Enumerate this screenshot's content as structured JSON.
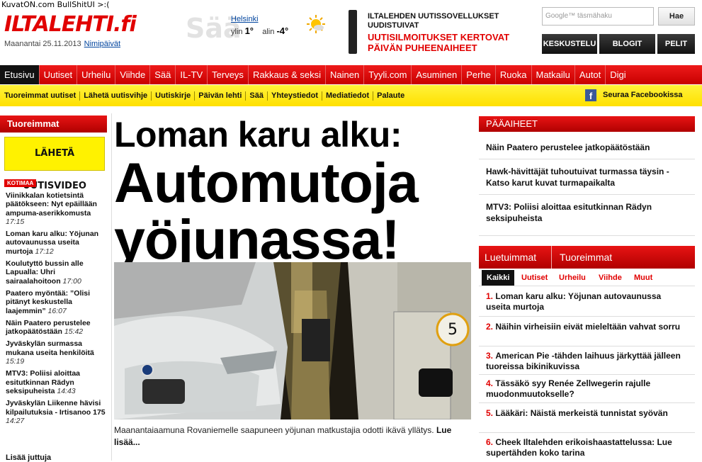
{
  "watermark": "KuvatON.com BullShitUI >:(",
  "brand": {
    "logo_main": "ILTALEHTI",
    "logo_suffix": ".fi",
    "date": "Maanantai 25.11.2013",
    "name_days": "Nimipäivät"
  },
  "weather": {
    "label": "Sää",
    "city": "Helsinki",
    "low_label": "ylin",
    "low": "1°",
    "high_label": "alin",
    "high": "-4°",
    "icon": "sun-cloud-icon"
  },
  "promo": {
    "line1": "ILTALEHDEN UUTISSOVELLUKSET UUDISTUIVAT",
    "line2": "UUTISILMOITUKSET KERTOVAT PÄIVÄN PUHEENAIHEET"
  },
  "search": {
    "placeholder": "Google™ täsmähaku",
    "button": "Hae"
  },
  "dark_buttons": [
    "KESKUSTELU",
    "BLOGIT",
    "PELIT"
  ],
  "nav": [
    "Etusivu",
    "Uutiset",
    "Urheilu",
    "Viihde",
    "Sää",
    "IL-TV",
    "Terveys",
    "Rakkaus & seksi",
    "Nainen",
    "Tyyli.com",
    "Asuminen",
    "Perhe",
    "Ruoka",
    "Matkailu",
    "Autot",
    "Digi"
  ],
  "subnav": [
    "Tuoreimmat uutiset",
    "Lähetä uutisvihje",
    "Uutiskirje",
    "Päivän lehti",
    "Sää",
    "Yhteystiedot",
    "Mediatiedot",
    "Palaute"
  ],
  "facebook": {
    "icon": "facebook-icon",
    "label": "Seuraa Facebookissa"
  },
  "left": {
    "header": "Tuoreimmat",
    "video_banner": "LÄHETÄ UUTISVIDEO",
    "section_badge": "KOTIMAA",
    "items": [
      {
        "title": "Viinikkalan kotietsintä päätökseen: Nyt epäillään ampuma-aserikkomusta",
        "time": "17:15"
      },
      {
        "title": "Loman karu alku: Yöjunan autovaunussa useita murtoja",
        "time": "17:12"
      },
      {
        "title": "Koulutyttö bussin alle Lapualla: Uhri sairaalahoitoon",
        "time": "17:00"
      },
      {
        "title": "Paatero myöntää: ”Olisi pitänyt keskustella laajemmin”",
        "time": "16:07"
      },
      {
        "title": "Näin Paatero perustelee jatkopäätöstään",
        "time": "15:42"
      },
      {
        "title": "Jyväskylän surmassa mukana useita henkilöitä",
        "time": "15:19"
      },
      {
        "title": "MTV3: Poliisi aloittaa esitutkinnan Rädyn seksipuheista",
        "time": "14:43"
      },
      {
        "title": "Jyväskylän Liikenne hävisi kilpailutuksia - Irtisanoo 175",
        "time": "14:27"
      }
    ],
    "more": "Lisää juttuja"
  },
  "main": {
    "headline_top": "Loman karu alku:",
    "headline_big1": "Automutoja",
    "headline_big2": "yöjunassa!",
    "caption": "Maanantaiaamuna Rovaniemelle saapuneen yöjunan matkustajia odotti ikävä yllätys.",
    "read_more": "Lue lisää..."
  },
  "right": {
    "header": "PÄÄAIHEET",
    "stories": [
      "Näin Paatero perustelee jatkopäätöstään",
      "Hawk-hävittäjät tuhoutuivat turmassa täysin - Katso karut kuvat turmapaikalta",
      "MTV3: Poliisi aloittaa esitutkinnan Rädyn seksipuheista"
    ],
    "tab_active": "Luetuimmat nyt",
    "tab_other": "Tuoreimmat",
    "subtabs": [
      "Kaikki",
      "Uutiset",
      "Urheilu",
      "Viihde",
      "Muut"
    ],
    "ranked": [
      "Loman karu alku: Yöjunan autovaunussa useita murtoja",
      "Näihin virheisiin eivät mieleltään vahvat sorru",
      "American Pie -tähden laihuus järkyttää jälleen tuoreissa bikinikuvissa",
      "Tässäkö syy Renée Zellwegerin rajulle muodonmuutokselle?",
      "Lääkäri: Näistä merkeistä tunnistat syövän",
      "Cheek Iltalehden erikoishaastattelussa: Lue supertähden koko tarina"
    ]
  }
}
